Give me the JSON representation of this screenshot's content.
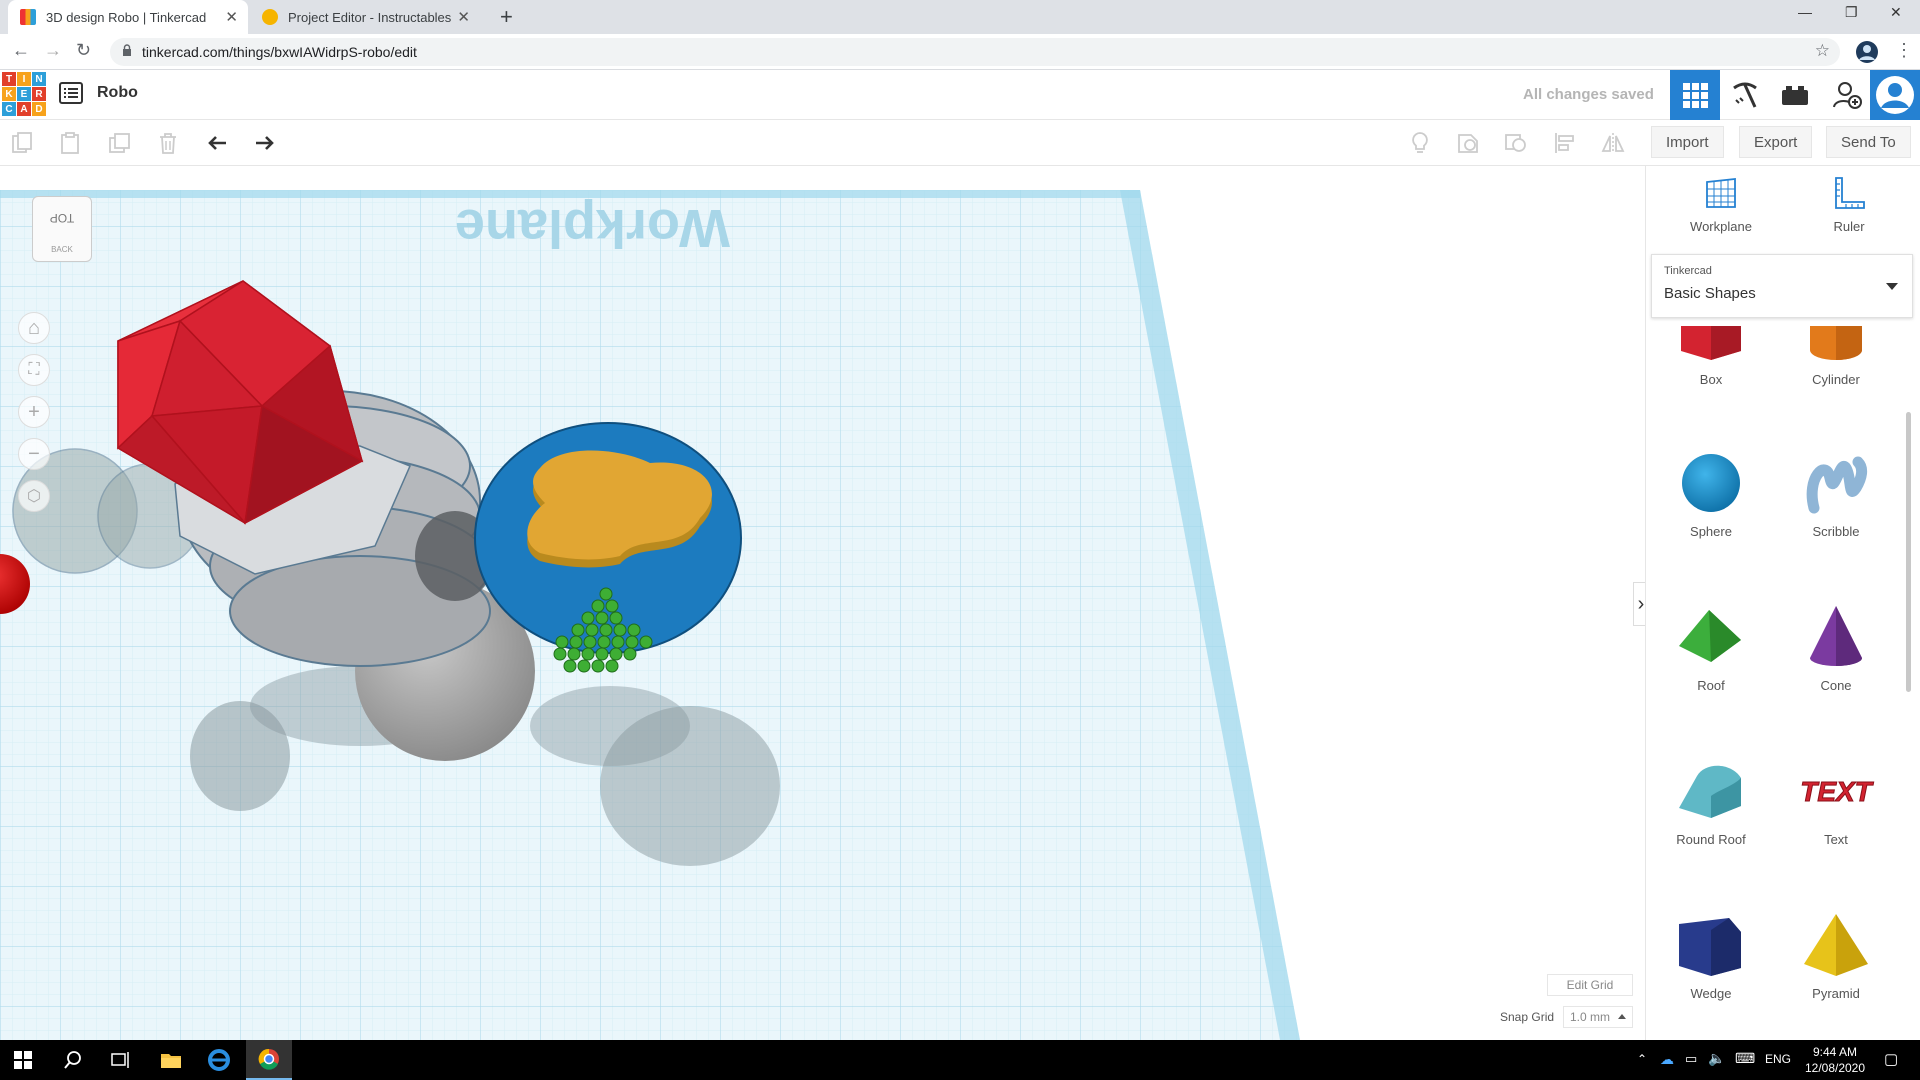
{
  "browser": {
    "tabs": [
      {
        "title": "3D design Robo | Tinkercad",
        "active": true
      },
      {
        "title": "Project Editor - Instructables",
        "active": false
      }
    ],
    "url": "tinkercad.com/things/bxwIAWidrpS-robo/edit"
  },
  "app": {
    "logo_letters": [
      "T",
      "I",
      "N",
      "K",
      "E",
      "R",
      "C",
      "A",
      "D"
    ],
    "design_title": "Robo",
    "save_status": "All changes saved"
  },
  "toolbar": {
    "import_label": "Import",
    "export_label": "Export",
    "send_to_label": "Send To"
  },
  "viewport": {
    "workplane_label": "Workplane",
    "viewcube_top": "TOP",
    "viewcube_back": "BACK",
    "edit_grid_label": "Edit Grid",
    "snap_grid_label": "Snap Grid",
    "snap_grid_value": "1.0 mm"
  },
  "panel": {
    "tools": [
      {
        "label": "Workplane",
        "icon": "workplane-icon"
      },
      {
        "label": "Ruler",
        "icon": "ruler-icon"
      }
    ],
    "library_source": "Tinkercad",
    "library_category": "Basic Shapes",
    "shapes": [
      {
        "label": "Box",
        "color": "#d32330"
      },
      {
        "label": "Cylinder",
        "color": "#e27a1b"
      },
      {
        "label": "Sphere",
        "color": "#1a9ad6"
      },
      {
        "label": "Scribble",
        "color": "#8fb5d6"
      },
      {
        "label": "Roof",
        "color": "#3cae3c"
      },
      {
        "label": "Cone",
        "color": "#7b3aa0"
      },
      {
        "label": "Round Roof",
        "color": "#5fb8c6"
      },
      {
        "label": "Text",
        "color": "#d32330"
      },
      {
        "label": "Wedge",
        "color": "#283b8c"
      },
      {
        "label": "Pyramid",
        "color": "#e7c31a"
      }
    ]
  },
  "taskbar": {
    "language": "ENG",
    "time": "9:44 AM",
    "date": "12/08/2020"
  },
  "colors": {
    "accent": "#2581d2",
    "grid": "#c9e7f2",
    "workplane_edge": "#9fd8ec"
  }
}
